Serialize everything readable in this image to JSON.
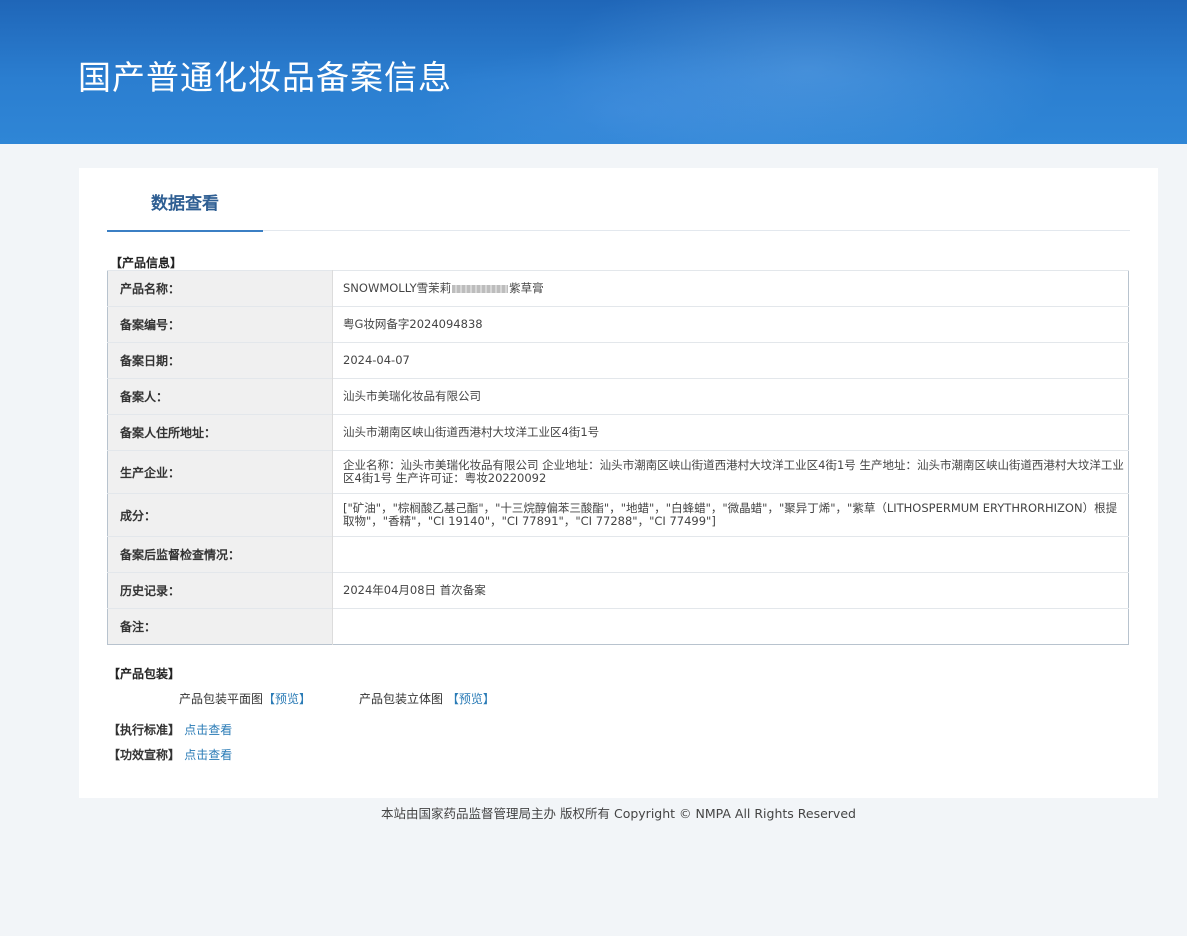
{
  "header": {
    "title": "国产普通化妆品备案信息"
  },
  "tab": {
    "label": "数据查看"
  },
  "product_info": {
    "section_label": "【产品信息】",
    "rows": [
      {
        "label": "产品名称：",
        "value_prefix": "SNOWMOLLY雪茉莉",
        "value_suffix": "紫草膏"
      },
      {
        "label": "备案编号：",
        "value": "粤G妆网备字2024094838"
      },
      {
        "label": "备案日期：",
        "value": "2024-04-07"
      },
      {
        "label": "备案人：",
        "value": "汕头市美瑞化妆品有限公司"
      },
      {
        "label": "备案人住所地址：",
        "value": "汕头市潮南区峡山街道西港村大坟洋工业区4街1号"
      },
      {
        "label": "生产企业：",
        "value": "企业名称：汕头市美瑞化妆品有限公司 企业地址：汕头市潮南区峡山街道西港村大坟洋工业区4街1号 生产地址：汕头市潮南区峡山街道西港村大坟洋工业区4街1号 生产许可证：粤妆20220092"
      },
      {
        "label": "成分：",
        "value": "[\"矿油\"，\"棕榈酸乙基己酯\"，\"十三烷醇偏苯三酸酯\"，\"地蜡\"，\"白蜂蜡\"，\"微晶蜡\"，\"聚异丁烯\"，\"紫草（LITHOSPERMUM ERYTHRORHIZON）根提取物\"，\"香精\"，\"CI 19140\"，\"CI 77891\"，\"CI 77288\"，\"CI 77499\"]"
      },
      {
        "label": "备案后监督检查情况：",
        "value": ""
      },
      {
        "label": "历史记录：",
        "value": "2024年04月08日 首次备案"
      },
      {
        "label": "备注：",
        "value": ""
      }
    ]
  },
  "packaging": {
    "section_label": "【产品包装】",
    "flat_label": "产品包装平面图",
    "flat_preview": "【预览】",
    "stereo_label": "产品包装立体图",
    "stereo_preview": "【预览】"
  },
  "standard": {
    "label": "【执行标准】",
    "link": "点击查看"
  },
  "efficacy": {
    "label": "【功效宣称】",
    "link": "点击查看"
  },
  "footer": {
    "text": "本站由国家药品监督管理局主办 版权所有 Copyright © NMPA All Rights Reserved"
  }
}
